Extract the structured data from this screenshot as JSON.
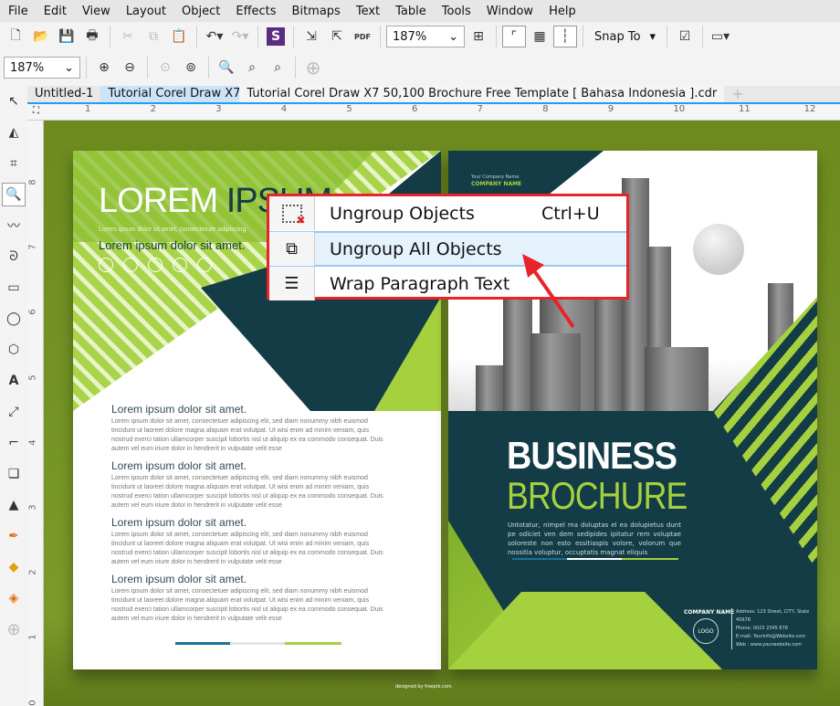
{
  "menu": [
    "File",
    "Edit",
    "View",
    "Layout",
    "Object",
    "Effects",
    "Bitmaps",
    "Text",
    "Table",
    "Tools",
    "Window",
    "Help"
  ],
  "toolbar": {
    "zoom_value": "187%",
    "snap_label": "Snap To"
  },
  "toolbar2": {
    "zoom_value": "187%"
  },
  "tabs": [
    "Untitled-1",
    "Tutorial Corel Draw X7...",
    "Tutorial Corel Draw X7 50,100 Brochure Free Template [ Bahasa Indonesia ].cdr"
  ],
  "hruler": [
    "1",
    "2",
    "3",
    "4",
    "5",
    "6",
    "7",
    "8",
    "9",
    "10",
    "11",
    "12"
  ],
  "vruler": [
    "8",
    "7",
    "6",
    "5",
    "4",
    "3",
    "2",
    "1",
    "0"
  ],
  "context_menu": [
    {
      "label": "Ungroup Objects",
      "shortcut": "Ctrl+U"
    },
    {
      "label": "Ungroup All Objects",
      "shortcut": ""
    },
    {
      "label": "Wrap Paragraph Text",
      "shortcut": ""
    }
  ],
  "left_page": {
    "title_a": "LOREM",
    "title_b": "IPSUM",
    "subtitle_small": "Lorem ipsum dolor sit amet, consectetuer adipiscing",
    "subtitle": "Lorem ipsum dolor sit amet.",
    "sections": [
      {
        "heading": "Lorem ipsum dolor sit amet.",
        "body": "Lorem ipsum dolor sit amet, consectetuer adipiscing elit, sed diam nonummy nibh euismod tincidunt ut laoreet dolore magna aliquam erat volutpat. Ut wisi enim ad minim veniam, quis nostrud exerci tation ullamcorper suscipit lobortis nisl ut aliquip ex ea commodo consequat. Duis autem vel eum iriure dolor in hendrerit in vulputate velit esse"
      },
      {
        "heading": "Lorem ipsum dolor sit amet.",
        "body": "Lorem ipsum dolor sit amet, consectetuer adipiscing elit, sed diam nonummy nibh euismod tincidunt ut laoreet dolore magna aliquam erat volutpat. Ut wisi enim ad minim veniam, quis nostrud exerci tation ullamcorper suscipit lobortis nisl ut aliquip ex ea commodo consequat. Duis autem vel eum iriure dolor in hendrerit in vulputate velit esse"
      },
      {
        "heading": "Lorem ipsum dolor sit amet.",
        "body": "Lorem ipsum dolor sit amet, consectetuer adipiscing elit, sed diam nonummy nibh euismod tincidunt ut laoreet dolore magna aliquam erat volutpat. Ut wisi enim ad minim veniam, quis nostrud exerci tation ullamcorper suscipit lobortis nisl ut aliquip ex ea commodo consequat. Duis autem vel eum iriure dolor in hendrerit in vulputate velit esse"
      },
      {
        "heading": "Lorem ipsum dolor sit amet.",
        "body": "Lorem ipsum dolor sit amet, consectetuer adipiscing elit, sed diam nonummy nibh euismod tincidunt ut laoreet dolore magna aliquam erat volutpat. Ut wisi enim ad minim veniam, quis nostrud exerci tation ullamcorper suscipit lobortis nisl ut aliquip ex ea commodo consequat. Duis autem vel eum iriure dolor in hendrerit in vulputate velit esse"
      }
    ]
  },
  "right_page": {
    "company_small": "Your Company Name",
    "company": "COMPANY NAME",
    "title1": "BUSINESS",
    "title2": "BROCHURE",
    "blurb": "Untotatur, nimpel ma doluptas el ea dolupietus dunt pe odiciet ven dem sedipides ipitatur rem voluptae soloreste non esto essitiaspis volore, volorum que nossitia voluptur, occuptatis magnat eliquis",
    "footer_company": "COMPANY NAME",
    "logo": "LOGO",
    "address": "Address: 123 Street, CITY, State 45678",
    "phone": "Phone: 0023 2345 678",
    "email": "E-mail: Yourinfo@Website.com",
    "web": "Web : www.yourwebsite.com"
  },
  "credit": "designed by freepik.com",
  "colors": {
    "canvas": "#718f22",
    "teal": "#143c47",
    "lime": "#a6d13f",
    "highlight_border": "#e8232a"
  }
}
